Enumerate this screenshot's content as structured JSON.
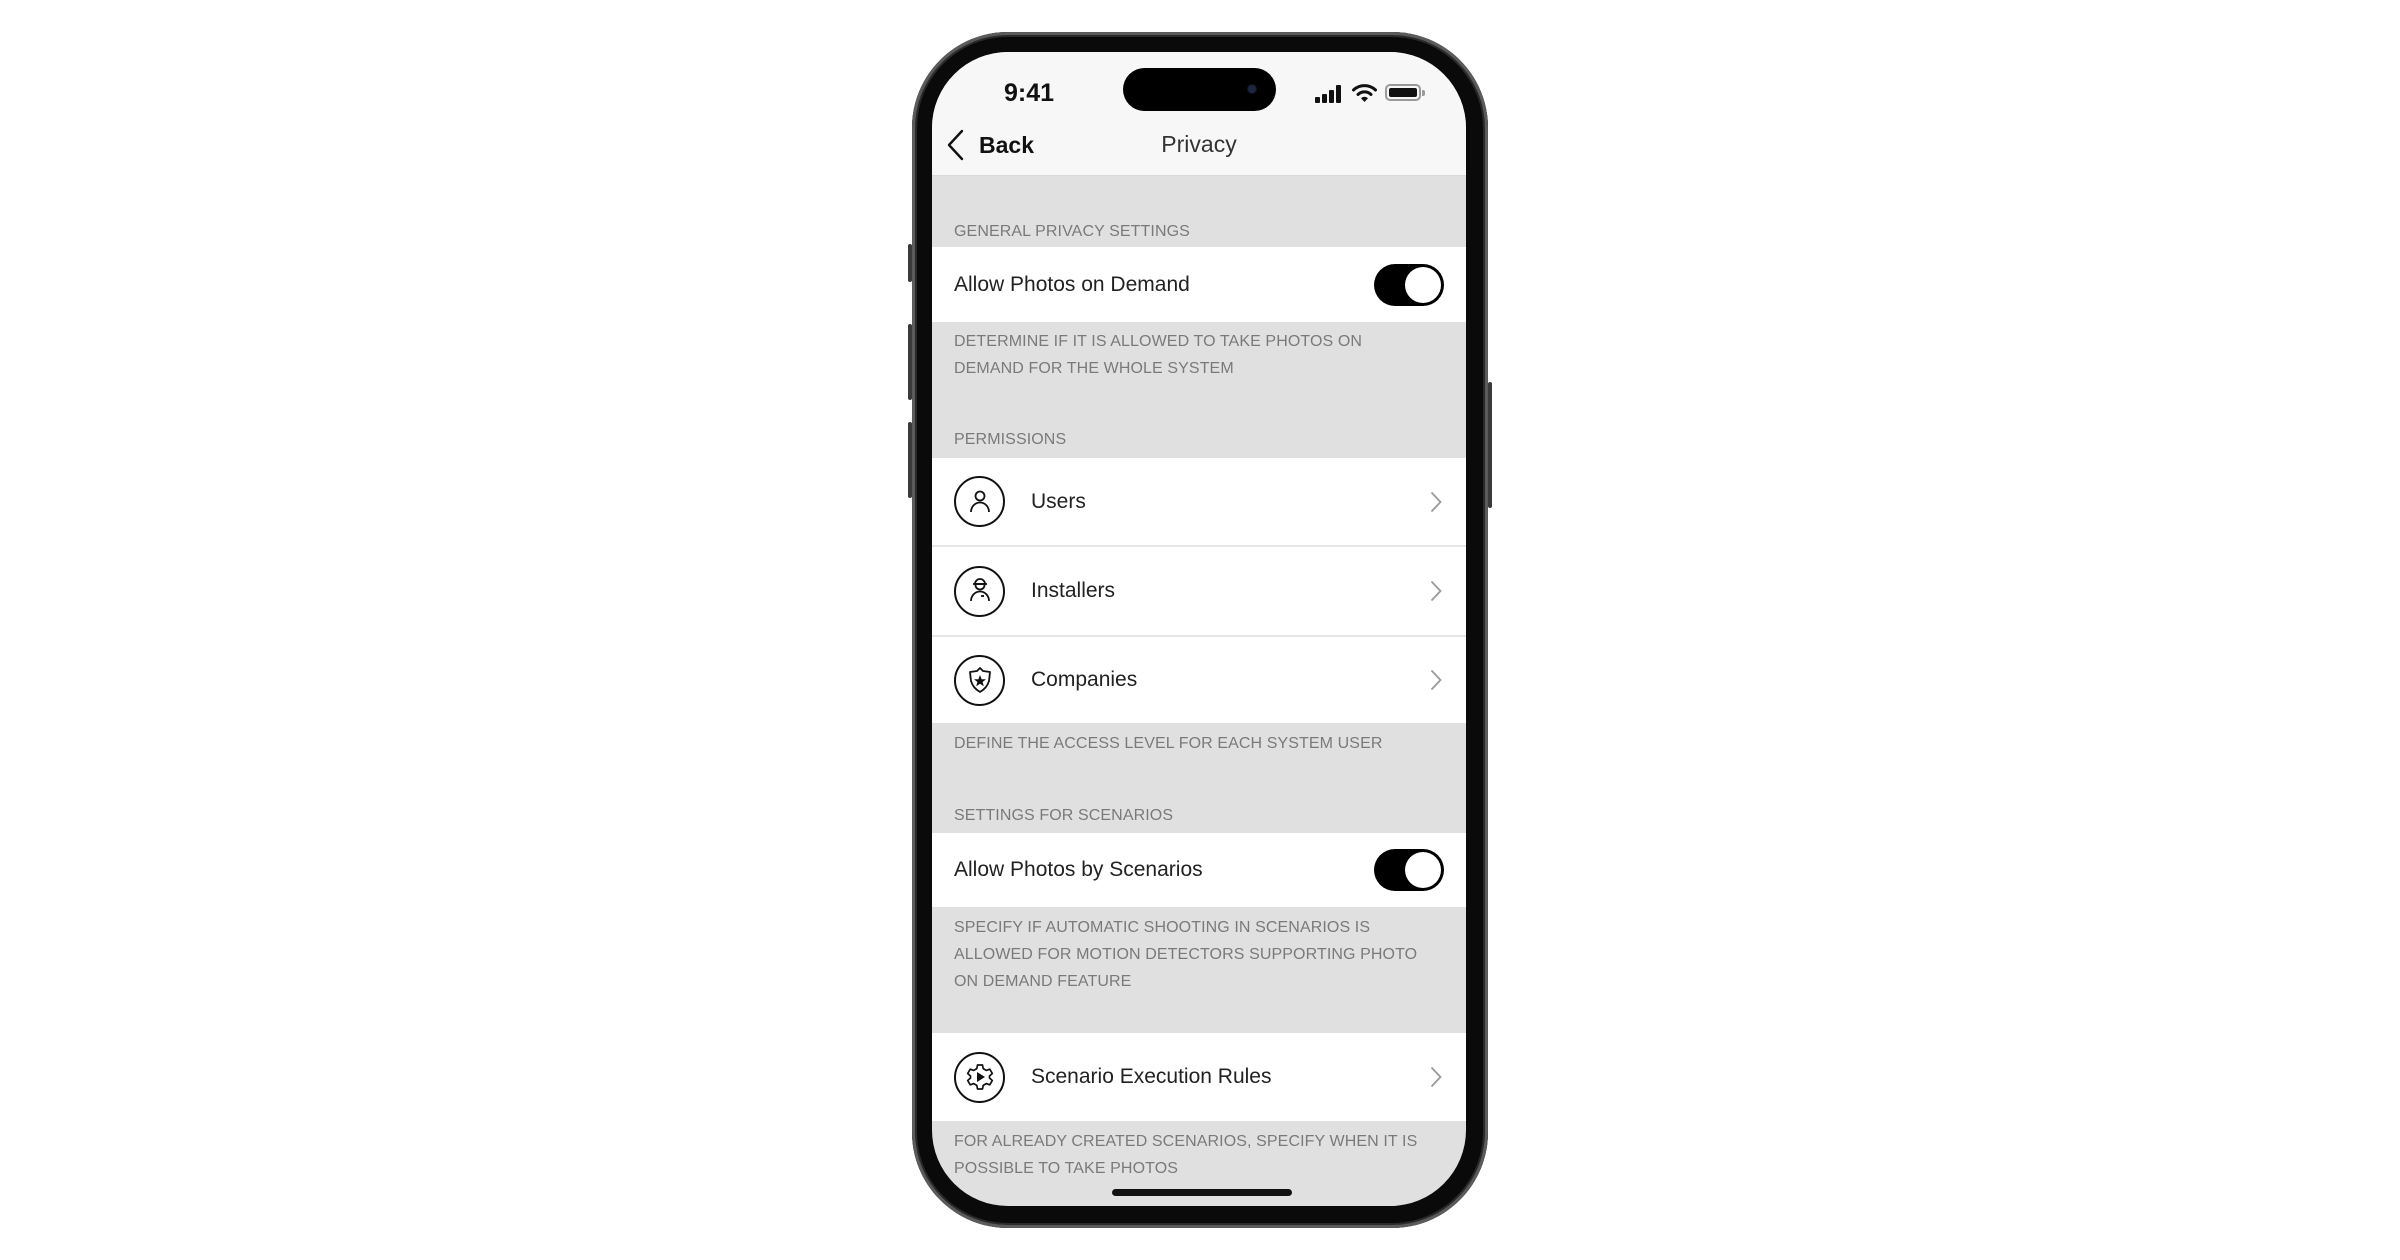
{
  "status_bar": {
    "time": "9:41",
    "signal_icon": "cellular-signal-icon",
    "wifi_icon": "wifi-icon",
    "battery_icon": "battery-icon"
  },
  "nav": {
    "back_label": "Back",
    "title": "Privacy"
  },
  "sections": {
    "general": {
      "header": "GENERAL PRIVACY SETTINGS",
      "toggle_label": "Allow Photos on Demand",
      "toggle_on": true,
      "description_lines": [
        "DETERMINE IF IT IS ALLOWED TO TAKE PHOTOS ON",
        "DEMAND FOR THE WHOLE SYSTEM"
      ]
    },
    "permissions": {
      "header": "PERMISSIONS",
      "items": [
        {
          "label": "Users",
          "icon": "user-icon"
        },
        {
          "label": "Installers",
          "icon": "installer-icon"
        },
        {
          "label": "Companies",
          "icon": "shield-star-icon"
        }
      ],
      "description": "DEFINE THE ACCESS LEVEL FOR EACH SYSTEM USER"
    },
    "scenarios": {
      "header": "SETTINGS FOR SCENARIOS",
      "toggle_label": "Allow Photos by Scenarios",
      "toggle_on": true,
      "description_lines": [
        "SPECIFY IF AUTOMATIC SHOOTING IN SCENARIOS IS",
        "ALLOWED FOR MOTION DETECTORS SUPPORTING PHOTO",
        "ON DEMAND FEATURE"
      ]
    },
    "execution": {
      "item_label": "Scenario Execution Rules",
      "icon": "gear-play-icon",
      "description_lines": [
        "FOR ALREADY CREATED SCENARIOS, SPECIFY WHEN IT IS",
        "POSSIBLE TO TAKE PHOTOS"
      ]
    }
  },
  "colors": {
    "toggle_on": "#000000",
    "section_bg": "#e0e0e0",
    "row_bg": "#ffffff",
    "caption_text": "#7a7a7a"
  }
}
